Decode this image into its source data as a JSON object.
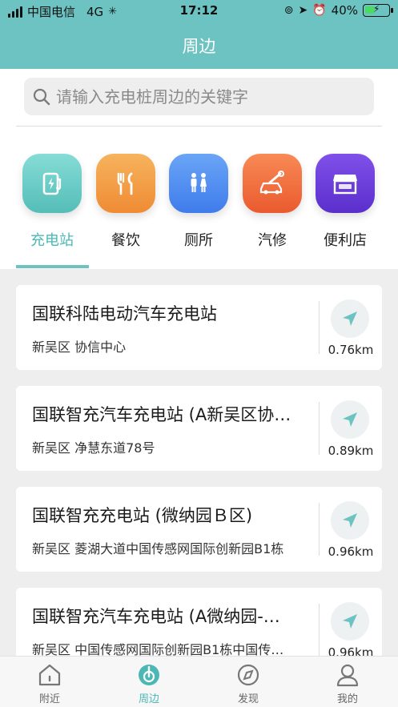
{
  "status_bar": {
    "carrier": "中国电信",
    "network": "4G",
    "time": "17:12",
    "battery": "40%"
  },
  "header": {
    "title": "周边"
  },
  "search": {
    "placeholder": "请输入充电桩周边的关键字"
  },
  "categories": [
    {
      "label": "充电站",
      "icon": "charging-station-icon",
      "color": "#6cc9c4",
      "active": true
    },
    {
      "label": "餐饮",
      "icon": "fork-knife-icon",
      "color": "#f39a45",
      "active": false
    },
    {
      "label": "厕所",
      "icon": "restroom-icon",
      "color": "#4f8cf2",
      "active": false
    },
    {
      "label": "汽修",
      "icon": "car-repair-icon",
      "color": "#f06c3c",
      "active": false
    },
    {
      "label": "便利店",
      "icon": "store-icon",
      "color": "#6a3fd6",
      "active": false
    }
  ],
  "stations": [
    {
      "name": "国联科陆电动汽车充电站",
      "address": "新吴区 协信中心",
      "distance": "0.76km"
    },
    {
      "name": "国联智充汽车充电站 (A新吴区协…",
      "address": "新吴区 净慧东道78号",
      "distance": "0.89km"
    },
    {
      "name": "国联智充充电站 (微纳园Ｂ区)",
      "address": "新吴区 菱湖大道中国传感网国际创新园B1栋",
      "distance": "0.96km"
    },
    {
      "name": "国联智充汽车充电站 (A微纳园-…",
      "address": "新吴区 中国传感网国际创新园B1栋中国传…",
      "distance": "0.96km"
    }
  ],
  "tabbar": [
    {
      "label": "附近",
      "icon": "home-icon",
      "active": false
    },
    {
      "label": "周边",
      "icon": "nearby-icon",
      "active": true
    },
    {
      "label": "发现",
      "icon": "compass-icon",
      "active": false
    },
    {
      "label": "我的",
      "icon": "user-icon",
      "active": false
    }
  ],
  "colors": {
    "accent": "#6cc3c1",
    "accent_text": "#4bb8b6"
  }
}
